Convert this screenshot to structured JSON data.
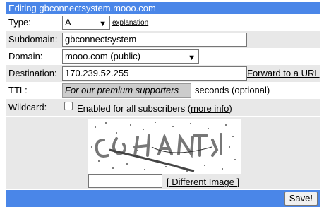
{
  "title": "Editing gbconnectsystem.mooo.com",
  "type": {
    "label": "Type:",
    "value": "A",
    "explanation_link": "explanation"
  },
  "subdomain": {
    "label": "Subdomain:",
    "value": "gbconnectsystem"
  },
  "domain": {
    "label": "Domain:",
    "value": "mooo.com (public)"
  },
  "destination": {
    "label": "Destination:",
    "value": "170.239.52.255",
    "forward_link": "Forward to a URL"
  },
  "ttl": {
    "label": "TTL:",
    "value": "For our premium supporters",
    "suffix": "seconds (optional)"
  },
  "wildcard": {
    "label": "Wildcard:",
    "text": "Enabled for all subscribers (",
    "more_info": "more info",
    "close": ")",
    "checked": false
  },
  "captcha": {
    "different_image": "[ Different Image ]",
    "input_value": ""
  },
  "save_label": "Save!",
  "colors": {
    "accent": "#4a86e8",
    "row_shade": "#e8e8e8",
    "premium_bg": "#cccccc"
  }
}
